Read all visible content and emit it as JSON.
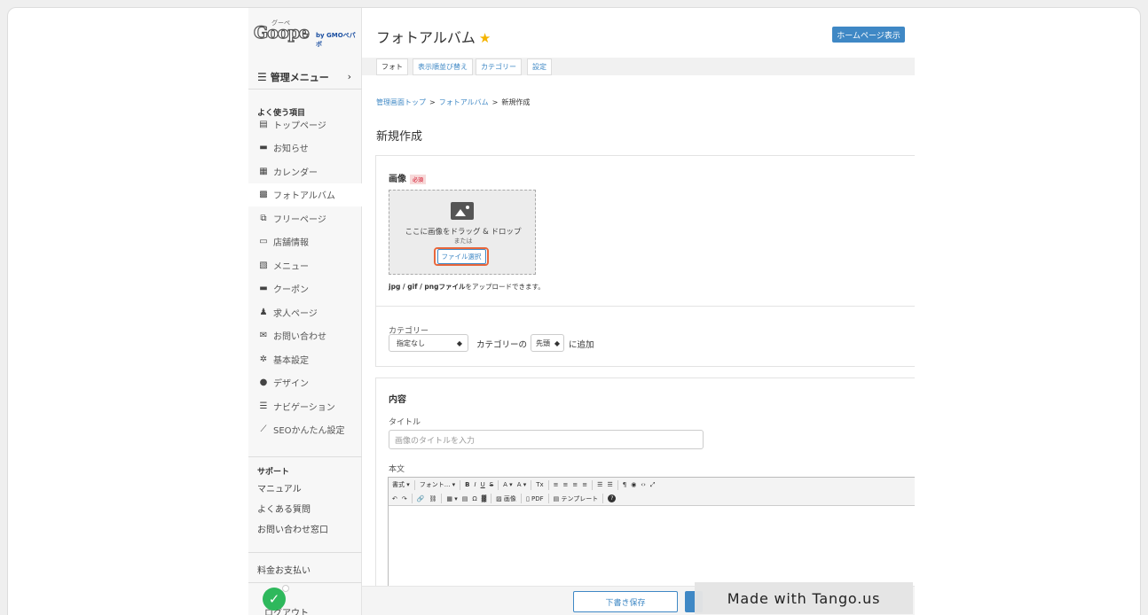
{
  "brand": {
    "logo_main": "Goope",
    "logo_small": "グーペ",
    "logo_by": "by GMOペパボ"
  },
  "sidebar": {
    "menu_label": "管理メニュー",
    "menu_arrow": "›",
    "favorites_head": "よく使う項目",
    "items": [
      {
        "icon": "▤",
        "label": "トップページ"
      },
      {
        "icon": "▬",
        "label": "お知らせ"
      },
      {
        "icon": "▦",
        "label": "カレンダー"
      },
      {
        "icon": "▩",
        "label": "フォトアルバム"
      },
      {
        "icon": "⧉",
        "label": "フリーページ"
      },
      {
        "icon": "▭",
        "label": "店舗情報"
      },
      {
        "icon": "▧",
        "label": "メニュー"
      },
      {
        "icon": "▬",
        "label": "クーポン"
      },
      {
        "icon": "♟",
        "label": "求人ページ"
      },
      {
        "icon": "✉",
        "label": "お問い合わせ"
      },
      {
        "icon": "✲",
        "label": "基本設定"
      },
      {
        "icon": "●",
        "label": "デザイン"
      },
      {
        "icon": "☰",
        "label": "ナビゲーション"
      },
      {
        "icon": "⟋",
        "label": "SEOかんたん設定"
      }
    ],
    "support_head": "サポート",
    "support_items": [
      "マニュアル",
      "よくある質問",
      "お問い合わせ窓口"
    ],
    "billing": "料金お支払い",
    "logout": "ログアウト"
  },
  "header": {
    "title": "フォトアルバム",
    "star": "★",
    "homepage_button": "ホームページ表示"
  },
  "tabs": [
    "フォト",
    "表示順並び替え",
    "カテゴリー",
    "設定"
  ],
  "breadcrumb": {
    "home": "管理画面トップ",
    "sep": ">",
    "album": "フォトアルバム",
    "current": "新規作成"
  },
  "page": {
    "heading": "新規作成"
  },
  "image_section": {
    "label": "画像",
    "required": "必須",
    "drop_text": "ここに画像をドラッグ & ドロップ",
    "or_text": "または",
    "file_button": "ファイル選択",
    "formats_bold": "jpg / gif / pngファイル",
    "formats_rest": "をアップロードできます。"
  },
  "category_section": {
    "label": "カテゴリー",
    "select_value": "指定なし",
    "middle_text": "カテゴリーの",
    "position_value": "先頭",
    "suffix": "に追加"
  },
  "content_section": {
    "label": "内容",
    "title_label": "タイトル",
    "title_placeholder": "画像のタイトルを入力",
    "body_label": "本文",
    "toolbar_row1": [
      "書式 ▾",
      "フォント... ▾",
      "B",
      "I",
      "U",
      "S",
      "A ▾",
      "A ▾",
      "Tx",
      "≡",
      "≡",
      "≡",
      "≡",
      "☰",
      "☰",
      "¶",
      "◉",
      "‹›",
      "⤢"
    ],
    "toolbar_row2": [
      "↶",
      "↷",
      "🔗",
      "⛓",
      "▦ ▾",
      "▤",
      "Ω",
      "▓",
      "▨ 画像",
      "▯ PDF",
      "▤ テンプレート",
      "?"
    ]
  },
  "footer": {
    "draft_button": "下書き保存"
  },
  "watermark": "Made with Tango.us",
  "colors": {
    "accent": "#3f88c5",
    "highlight": "#e8673c",
    "success": "#2eb85c",
    "star": "#f5b400"
  }
}
